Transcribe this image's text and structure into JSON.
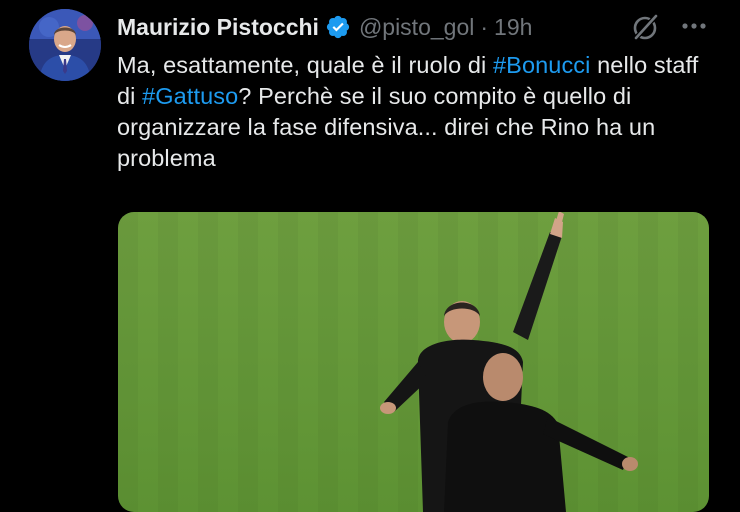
{
  "author": {
    "display_name": "Maurizio Pistocchi",
    "handle": "@pisto_gol",
    "separator": "·",
    "time": "19h",
    "verified": true
  },
  "tweet": {
    "text_parts": {
      "p1": "Ma, esattamente, quale è il ruolo di ",
      "h1": "#Bonucci",
      "p2": " nello staff di ",
      "h2": "#Gattuso",
      "p3": "? Perchè se il suo compito è quello di organizzare la fase difensiva... direi che Rino ha un problema"
    }
  },
  "icons": {
    "verified": "verified-badge-icon",
    "grok": "grok-icon",
    "more": "more-options-icon"
  },
  "colors": {
    "background": "#000000",
    "text": "#e7e9ea",
    "muted": "#71767b",
    "accent": "#1d9bf0"
  },
  "media": {
    "type": "video",
    "description_icon": "video-thumbnail"
  }
}
